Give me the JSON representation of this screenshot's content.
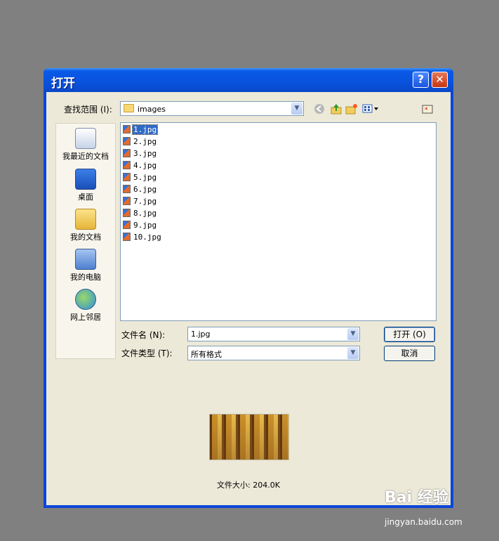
{
  "window": {
    "title": "打开"
  },
  "titlebar": {
    "help_symbol": "?",
    "close_symbol": "✕"
  },
  "lookin": {
    "label": "查找范围 (I):",
    "value": "images"
  },
  "toolbar": {
    "icons": [
      "back-icon",
      "up-folder-icon",
      "new-folder-icon",
      "view-menu-icon",
      "desktop-shortcut-icon"
    ]
  },
  "places": [
    {
      "label": "我最近的文档",
      "icon": "recent-documents-icon"
    },
    {
      "label": "桌面",
      "icon": "desktop-icon"
    },
    {
      "label": "我的文档",
      "icon": "my-documents-icon"
    },
    {
      "label": "我的电脑",
      "icon": "my-computer-icon"
    },
    {
      "label": "网上邻居",
      "icon": "network-places-icon"
    }
  ],
  "files": [
    {
      "name": "1.jpg",
      "selected": true
    },
    {
      "name": "2.jpg",
      "selected": false
    },
    {
      "name": "3.jpg",
      "selected": false
    },
    {
      "name": "4.jpg",
      "selected": false
    },
    {
      "name": "5.jpg",
      "selected": false
    },
    {
      "name": "6.jpg",
      "selected": false
    },
    {
      "name": "7.jpg",
      "selected": false
    },
    {
      "name": "8.jpg",
      "selected": false
    },
    {
      "name": "9.jpg",
      "selected": false
    },
    {
      "name": "10.jpg",
      "selected": false
    }
  ],
  "filename": {
    "label": "文件名 (N):",
    "value": "1.jpg"
  },
  "filetype": {
    "label": "文件类型 (T):",
    "value": "所有格式"
  },
  "buttons": {
    "open": "打开 (O)",
    "cancel": "取消"
  },
  "preview": {
    "file_size": "文件大小: 204.0K"
  },
  "watermark": {
    "brand": "Bai 经验",
    "url": "jingyan.baidu.com"
  },
  "colors": {
    "titlebar": "#0a5ae6",
    "selection": "#316ac5",
    "dialog_bg": "#ece9d8",
    "screen_bg": "#808080"
  }
}
